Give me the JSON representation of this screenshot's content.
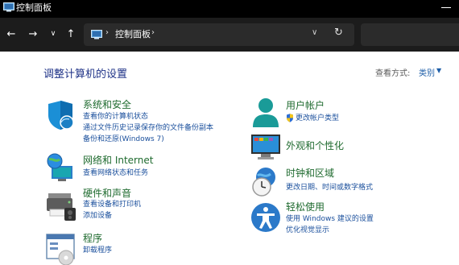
{
  "window": {
    "title": "控制面板"
  },
  "address": {
    "segment": "控制面板"
  },
  "page": {
    "heading": "调整计算机的设置",
    "view_by_label": "查看方式:",
    "view_by_value": "类别"
  },
  "categories": {
    "system": {
      "title": "系统和安全",
      "links": [
        "查看你的计算机状态",
        "通过文件历史记录保存你的文件备份副本",
        "备份和还原(Windows 7)"
      ],
      "icon": "shield-icon"
    },
    "network": {
      "title": "网络和 Internet",
      "links": [
        "查看网络状态和任务"
      ],
      "icon": "globe-network-icon"
    },
    "hardware": {
      "title": "硬件和声音",
      "links": [
        "查看设备和打印机",
        "添加设备"
      ],
      "icon": "printer-speaker-icon"
    },
    "programs": {
      "title": "程序",
      "links": [
        "卸载程序"
      ],
      "icon": "programs-icon"
    },
    "user": {
      "title": "用户帐户",
      "links": [
        "更改帐户类型"
      ],
      "icon": "user-icon"
    },
    "appearance": {
      "title": "外观和个性化",
      "links": [],
      "icon": "monitor-icon"
    },
    "clock": {
      "title": "时钟和区域",
      "links": [
        "更改日期、时间或数字格式"
      ],
      "icon": "clock-globe-icon"
    },
    "ease": {
      "title": "轻松使用",
      "links": [
        "使用 Windows 建议的设置",
        "优化视觉显示"
      ],
      "icon": "accessibility-icon"
    }
  },
  "colors": {
    "title_bar": "#000000",
    "nav_bar": "#1c1c1c",
    "category_title": "#1f6b2f",
    "link": "#1a4f9c",
    "heading": "#1e3287"
  }
}
